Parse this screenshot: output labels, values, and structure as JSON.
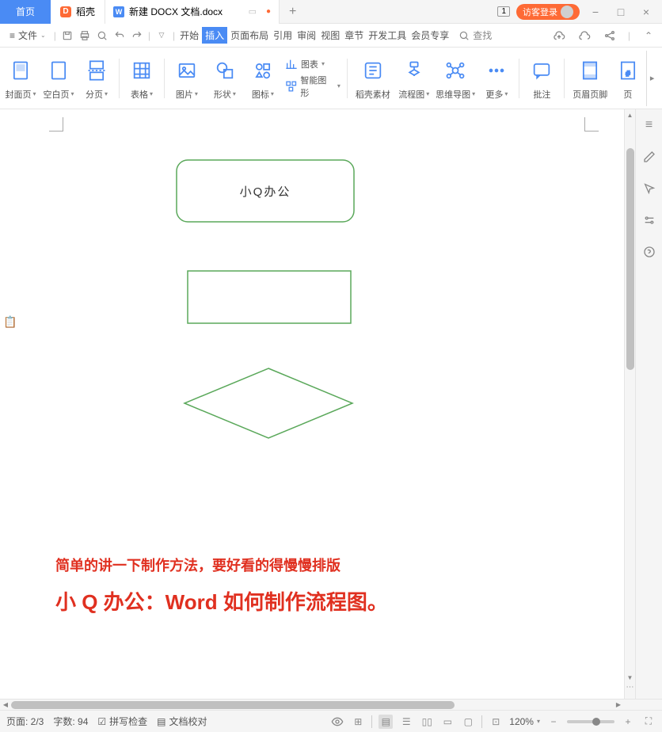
{
  "titlebar": {
    "home": "首页",
    "docer": "稻壳",
    "doc_name": "新建 DOCX 文档.docx",
    "badge": "1",
    "login": "访客登录"
  },
  "menubar": {
    "file": "文件",
    "tabs": {
      "start": "开始",
      "insert": "插入",
      "layout": "页面布局",
      "reference": "引用",
      "review": "审阅",
      "view": "视图",
      "chapter": "章节",
      "devtools": "开发工具",
      "member": "会员专享"
    },
    "search": "查找"
  },
  "ribbon": {
    "cover": "封面页",
    "blank": "空白页",
    "pagebreak": "分页",
    "table": "表格",
    "picture": "图片",
    "shape": "形状",
    "icon": "图标",
    "chart": "图表",
    "smartart": "智能图形",
    "docer": "稻壳素材",
    "flowchart": "流程图",
    "mindmap": "思维导图",
    "more": "更多",
    "annotate": "批注",
    "header": "页眉页脚",
    "pagenum": "页"
  },
  "document": {
    "shape1_text": "小Q办公",
    "text1": "简单的讲一下制作方法，要好看的得慢慢排版",
    "text2": "小 Q 办公：Word 如何制作流程图。"
  },
  "statusbar": {
    "page": "页面: 2/3",
    "words": "字数: 94",
    "spellcheck": "拼写检查",
    "doccheck": "文档校对",
    "zoom": "120%"
  },
  "colors": {
    "primary": "#4a8bf4",
    "accent": "#fe6a35",
    "red_text": "#e03020",
    "shape_green": "#5aa85a"
  }
}
